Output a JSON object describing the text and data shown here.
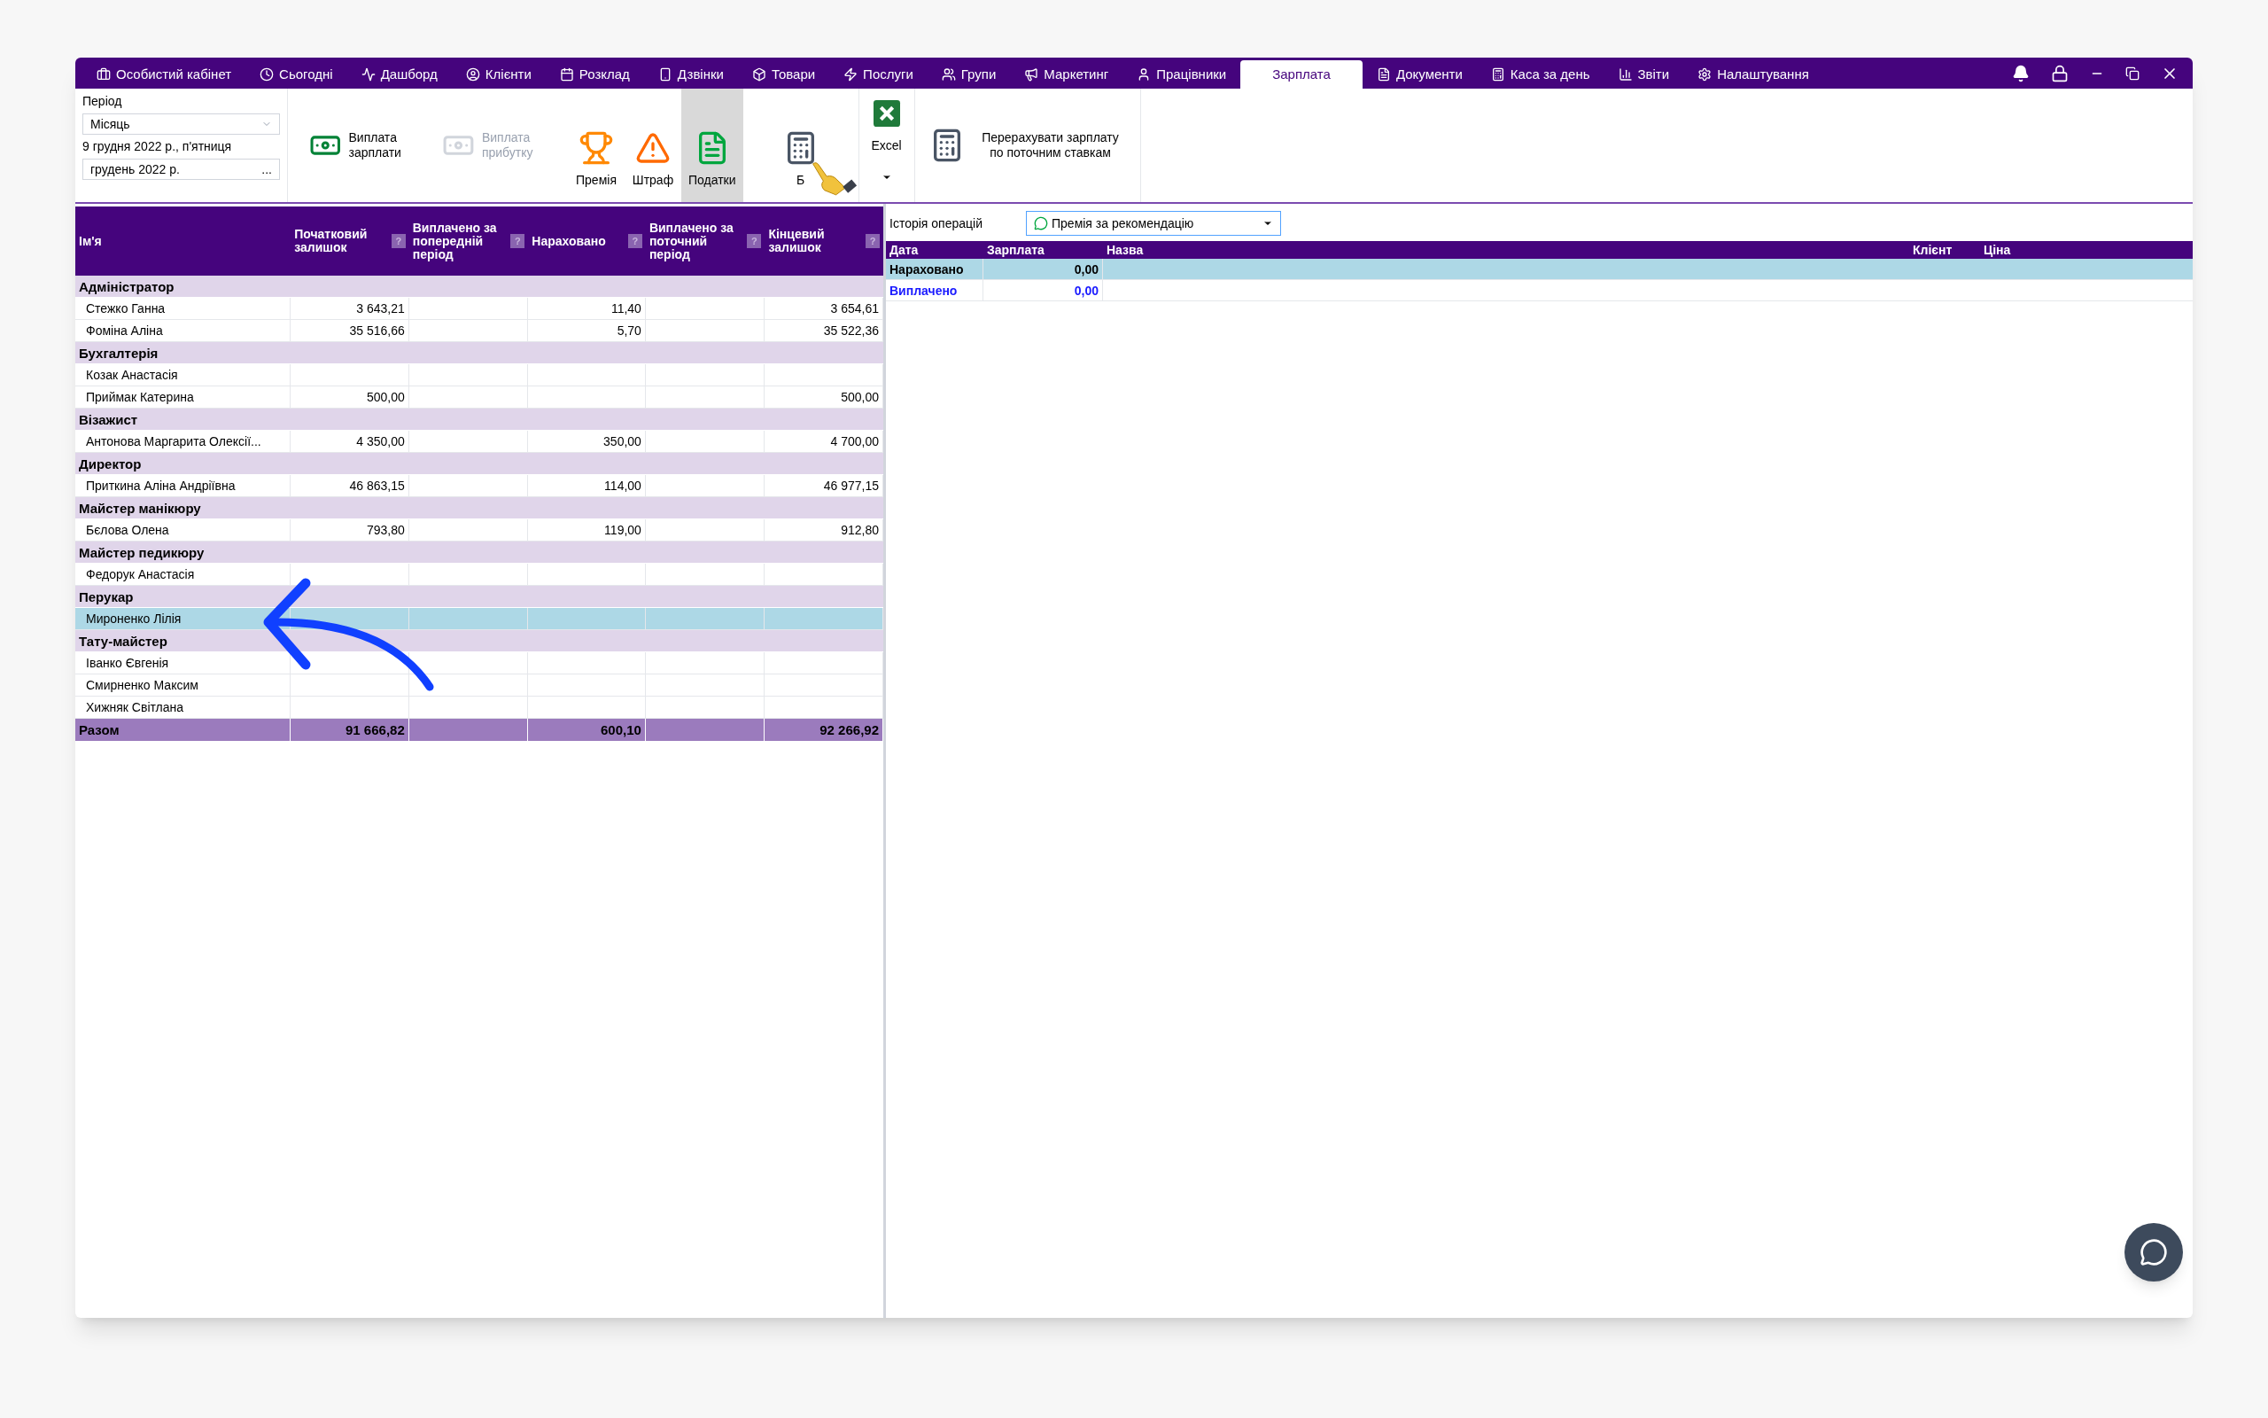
{
  "nav": {
    "tabs": [
      {
        "label": "Особистий кабінет",
        "selected": false
      },
      {
        "label": "Сьогодні",
        "selected": false
      },
      {
        "label": "Дашборд",
        "selected": false
      },
      {
        "label": "Клієнти",
        "selected": false
      },
      {
        "label": "Розклад",
        "selected": false
      },
      {
        "label": "Дзвінки",
        "selected": false
      },
      {
        "label": "Товари",
        "selected": false
      },
      {
        "label": "Послуги",
        "selected": false
      },
      {
        "label": "Групи",
        "selected": false
      },
      {
        "label": "Маркетинг",
        "selected": false
      },
      {
        "label": "Працівники",
        "selected": false
      },
      {
        "label": "Зарплата",
        "selected": true
      },
      {
        "label": "Документи",
        "selected": false
      },
      {
        "label": "Каса за день",
        "selected": false
      },
      {
        "label": "Звіти",
        "selected": false
      },
      {
        "label": "Налаштування",
        "selected": false
      }
    ]
  },
  "period": {
    "label": "Період",
    "mode": "Місяць",
    "date": "9 грудня 2022 р., п'ятниця",
    "month": "грудень  2022 р.",
    "picker": "..."
  },
  "toolbar": [
    {
      "kind": "pay",
      "label": "Виплата зарплати",
      "disabled": false,
      "selected": false
    },
    {
      "kind": "profit",
      "label": "Виплата прибутку",
      "disabled": true,
      "selected": false
    },
    {
      "kind": "bonus",
      "label": "Премія",
      "disabled": false,
      "selected": false
    },
    {
      "kind": "fine",
      "label": "Штраф",
      "disabled": false,
      "selected": false
    },
    {
      "kind": "tax",
      "label": "Податки",
      "disabled": false,
      "selected": true
    },
    {
      "kind": "calc",
      "label": "Б",
      "disabled": false,
      "selected": false
    },
    {
      "kind": "excel",
      "label": "Excel",
      "disabled": false,
      "selected": false
    }
  ],
  "recalc": {
    "label": "Перерахувати зарплату по поточним ставкам"
  },
  "table": {
    "columns": [
      "Ім'я",
      "Початковий залишок",
      "Виплачено за попередній період",
      "Нараховано",
      "Виплачено за поточний період",
      "Кінцевий залишок"
    ],
    "help": "?",
    "groups": [
      {
        "name": "Адміністратор",
        "rows": [
          {
            "name": "Стежко Ганна",
            "values": {
              "start": "3 643,21",
              "accrued": "11,40",
              "end": "3 654,61"
            },
            "selected": false
          },
          {
            "name": "Фоміна Аліна",
            "values": {
              "start": "35 516,66",
              "accrued": "5,70",
              "end": "35 522,36"
            },
            "selected": false
          }
        ]
      },
      {
        "name": "Бухгалтерія",
        "rows": [
          {
            "name": "Козак Анастасія",
            "values": {},
            "selected": false
          },
          {
            "name": "Приймак Катерина",
            "values": {
              "start": "500,00",
              "end": "500,00"
            },
            "selected": false
          }
        ]
      },
      {
        "name": "Візажист",
        "rows": [
          {
            "name": "Антонова Маргарита Олексії...",
            "values": {
              "start": "4 350,00",
              "accrued": "350,00",
              "end": "4 700,00"
            },
            "selected": false
          }
        ]
      },
      {
        "name": "Директор",
        "rows": [
          {
            "name": "Приткина Аліна Андріївна",
            "values": {
              "start": "46 863,15",
              "accrued": "114,00",
              "end": "46 977,15"
            },
            "selected": false
          }
        ]
      },
      {
        "name": "Майстер манікюру",
        "rows": [
          {
            "name": "Бєлова Олена",
            "values": {
              "start": "793,80",
              "accrued": "119,00",
              "end": "912,80"
            },
            "selected": false
          }
        ]
      },
      {
        "name": "Майстер педикюру",
        "rows": [
          {
            "name": "Федорук Анастасія",
            "values": {},
            "selected": false
          }
        ]
      },
      {
        "name": "Перукар",
        "rows": [
          {
            "name": "Мироненко Лілія",
            "values": {},
            "selected": true
          }
        ]
      },
      {
        "name": "Тату-майстер",
        "rows": [
          {
            "name": "Іванко Євгенія",
            "values": {},
            "selected": false
          },
          {
            "name": "Смирненко Максим",
            "values": {},
            "selected": false
          },
          {
            "name": "Хижняк Світлана",
            "values": {},
            "selected": false
          }
        ]
      }
    ],
    "total": {
      "label": "Разом",
      "values": {
        "start": "91 666,82",
        "accrued": "600,10",
        "end": "92 266,92"
      }
    }
  },
  "history": {
    "label": "Історія операцій",
    "filter": "Премія за рекомендацію",
    "columns": [
      "Дата",
      "Зарплата",
      "Назва",
      "Клієнт",
      "Ціна"
    ],
    "rows": [
      {
        "label": "Нараховано",
        "value": "0,00",
        "kind": "accrued",
        "selected": true
      },
      {
        "label": "Виплачено",
        "value": "0,00",
        "kind": "paid",
        "selected": false
      }
    ]
  }
}
